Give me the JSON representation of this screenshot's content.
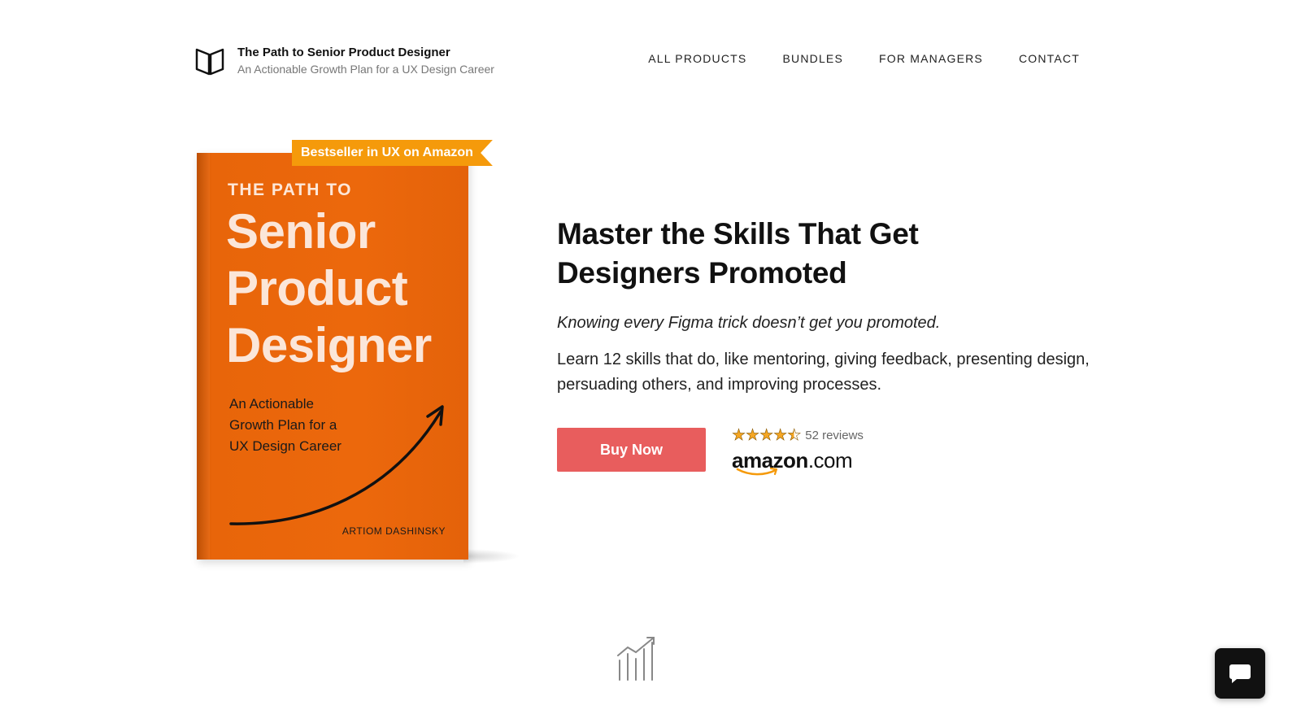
{
  "brand": {
    "title": "The Path to Senior Product Designer",
    "subtitle": "An Actionable Growth Plan for a UX Design Career"
  },
  "nav": {
    "items": [
      {
        "label": "ALL PRODUCTS"
      },
      {
        "label": "BUNDLES"
      },
      {
        "label": "FOR MANAGERS"
      },
      {
        "label": "CONTACT"
      }
    ]
  },
  "book": {
    "ribbon": "Bestseller in UX on Amazon",
    "kicker": "THE PATH TO",
    "title_lines": [
      "Senior",
      "Product",
      "Designer"
    ],
    "subtitle_lines": [
      "An Actionable",
      "Growth Plan for a",
      "UX Design Career"
    ],
    "author": "ARTIOM DASHINSKY",
    "cover_color": "#ec680c"
  },
  "hero": {
    "title_lines": [
      "Master the Skills That Get",
      "Designers Promoted"
    ],
    "tagline": "Knowing every Figma trick doesn’t get you promoted.",
    "description": "Learn 12 skills that do, like mentoring, giving feedback, presenting design, persuading others, and improving processes."
  },
  "cta": {
    "buy_label": "Buy Now",
    "button_color": "#e85d5d",
    "rating": 4.5,
    "rating_max": 5,
    "reviews_label": "52 reviews",
    "store_word": "amazon",
    "store_tld": ".com"
  },
  "icons": {
    "brand": "open-book-icon",
    "section": "bar-chart-growth-icon",
    "chat": "chat-bubble-icon"
  }
}
